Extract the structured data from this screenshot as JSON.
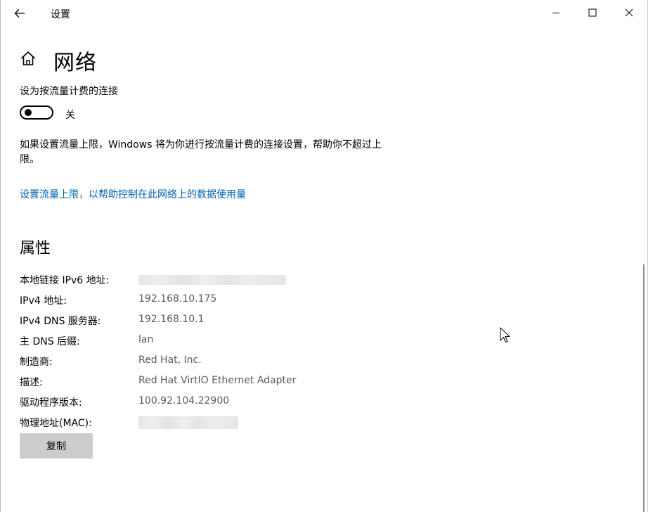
{
  "window": {
    "app_title": "设置",
    "icons": {
      "back": "back-arrow-icon",
      "minimize": "minimize-icon",
      "maximize": "maximize-icon",
      "close": "close-icon",
      "home": "home-icon"
    }
  },
  "page": {
    "title": "网络"
  },
  "metered": {
    "label": "设为按流量计费的连接",
    "toggle_state": "关",
    "toggle_on": false,
    "description": "如果设置流量上限，Windows 将为你进行按流量计费的连接设置，帮助你不超过上限。",
    "link": "设置流量上限，以帮助控制在此网络上的数据使用量"
  },
  "properties": {
    "title": "属性",
    "rows": [
      {
        "label": "本地链接 IPv6 地址:",
        "value": ""
      },
      {
        "label": "IPv4 地址:",
        "value": "192.168.10.175"
      },
      {
        "label": "IPv4 DNS 服务器:",
        "value": "192.168.10.1"
      },
      {
        "label": "主 DNS 后缀:",
        "value": "lan"
      },
      {
        "label": "制造商:",
        "value": "Red Hat, Inc."
      },
      {
        "label": "描述:",
        "value": "Red Hat VirtIO Ethernet Adapter"
      },
      {
        "label": "驱动程序版本:",
        "value": "100.92.104.22900"
      },
      {
        "label": "物理地址(MAC):",
        "value": ""
      }
    ],
    "copy_button": "复制"
  },
  "colors": {
    "link": "#0063b1",
    "value_text": "#5a5a5a",
    "button_bg": "#cccccc"
  }
}
